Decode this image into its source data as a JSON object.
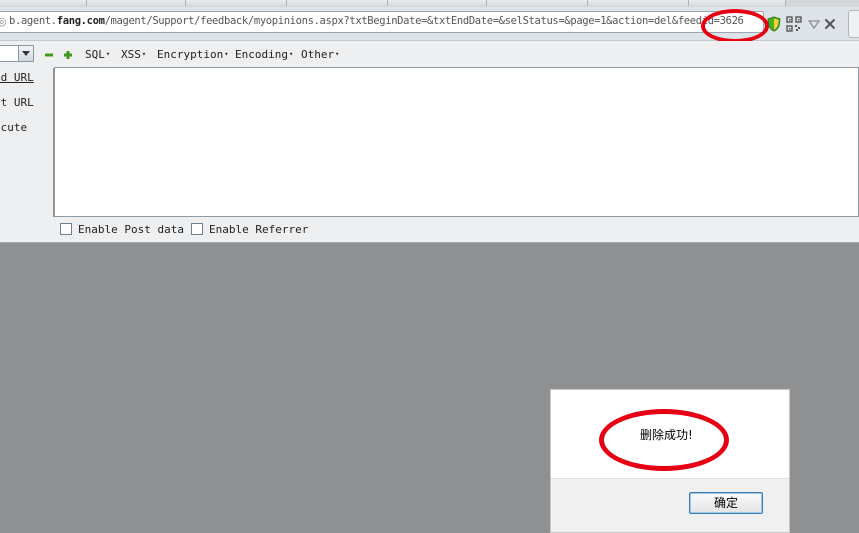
{
  "browser": {
    "url": {
      "host_prefix": "b.agent.",
      "host_domain": "fang.com",
      "path": "/magent/Support/feedback/myopinions.aspx?txtBeginDate=&txtEndDate=&selStatus=&page=1&action=del&feedid=3626"
    },
    "icons": [
      "page-icon",
      "shield-icon",
      "qr-code-icon",
      "dropdown-icon",
      "close-icon"
    ]
  },
  "hackbar": {
    "menus": [
      {
        "label": "SQL"
      },
      {
        "label": "XSS"
      },
      {
        "label": "Encryption"
      },
      {
        "label": "Encoding"
      },
      {
        "label": "Other"
      }
    ],
    "caret": "▾",
    "side_actions": {
      "load_url_visible": "ad URL",
      "split_url_visible": "it URL",
      "execute_visible": "ecute"
    },
    "editor_value": "",
    "options": {
      "post_data_label": "Enable Post data",
      "post_data_checked": false,
      "referrer_label": "Enable Referrer",
      "referrer_checked": false
    }
  },
  "dialog": {
    "message": "删除成功!",
    "ok_label": "确定"
  },
  "colors": {
    "highlight": "#e60012",
    "page_background": "#8f9091"
  }
}
